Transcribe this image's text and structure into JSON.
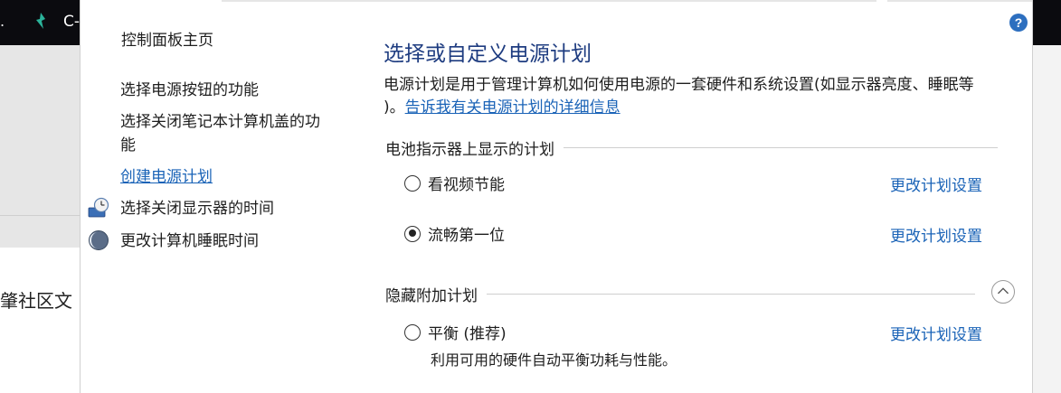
{
  "background": {
    "top_left_text": ".",
    "title_fragment": "C-",
    "bottom_text": "肇社区文"
  },
  "window": {
    "help_label": "?"
  },
  "sidebar": {
    "home": "控制面板主页",
    "items": [
      {
        "label": "选择电源按钮的功能"
      },
      {
        "label": "选择关闭笔记本计算机盖的功",
        "label2": "能"
      },
      {
        "label": "创建电源计划"
      },
      {
        "label": "选择关闭显示器的时间",
        "icon": "display-clock-icon"
      },
      {
        "label": "更改计算机睡眠时间",
        "icon": "moon-icon"
      }
    ]
  },
  "main": {
    "title": "选择或自定义电源计划",
    "desc_line1": "电源计划是用于管理计算机如何使用电源的一套硬件和系统设置(如显示器亮度、睡眠等",
    "desc_line2_prefix": ")。",
    "desc_link": "告诉我有关电源计划的详细信息",
    "battery_section": "电池指示器上显示的计划",
    "hidden_section": "隐藏附加计划",
    "plans": [
      {
        "name": "看视频节能",
        "selected": false,
        "change": "更改计划设置"
      },
      {
        "name": "流畅第一位",
        "selected": true,
        "change": "更改计划设置"
      },
      {
        "name": "平衡 (推荐)",
        "selected": false,
        "change": "更改计划设置",
        "desc": "利用可用的硬件自动平衡功耗与性能。"
      }
    ]
  },
  "colors": {
    "title": "#1e3c80",
    "link": "#1a63b7",
    "help": "#2d6fbf"
  }
}
